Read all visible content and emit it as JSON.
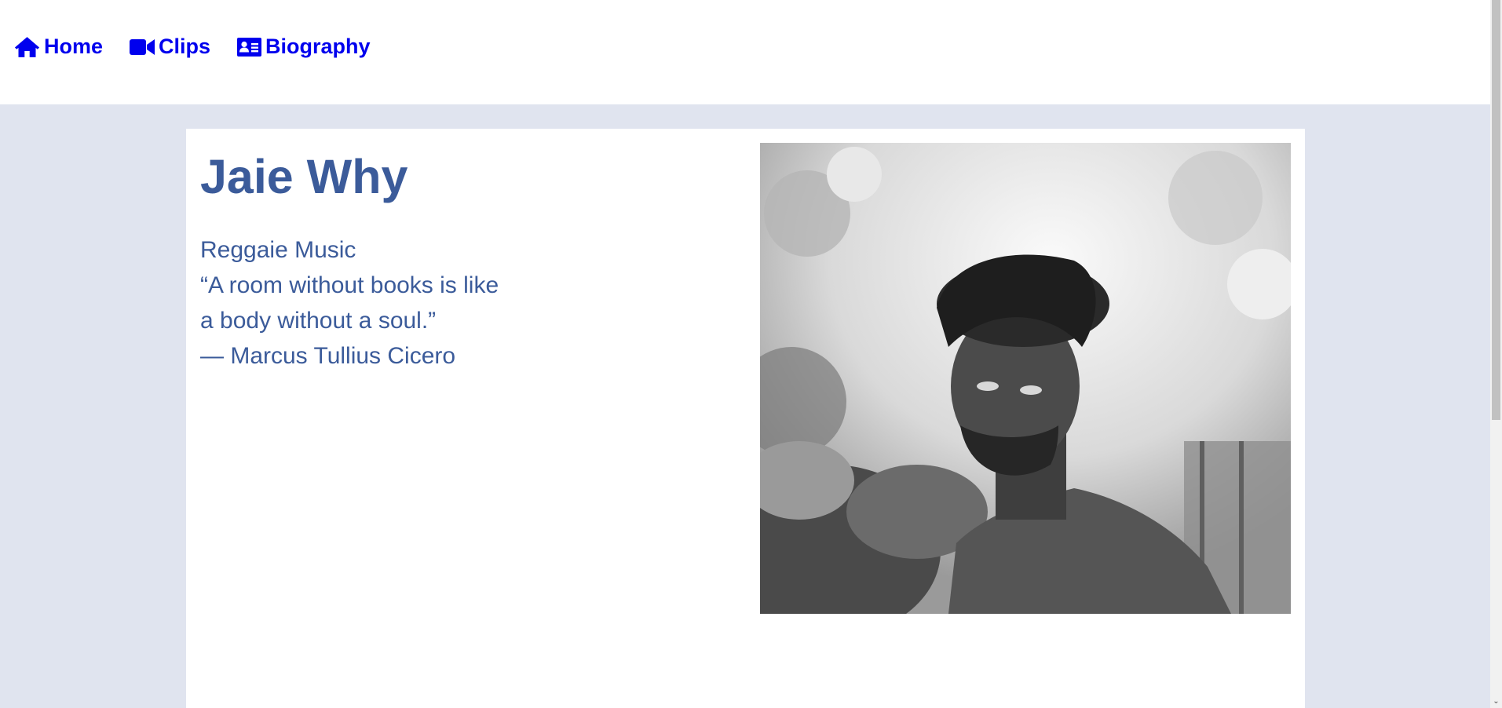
{
  "nav": {
    "items": [
      {
        "label": "Home",
        "icon": "home-icon"
      },
      {
        "label": "Clips",
        "icon": "video-camera-icon"
      },
      {
        "label": "Biography",
        "icon": "id-card-icon"
      }
    ],
    "link_color": "#0000ee"
  },
  "hero": {
    "name": "Jaie Why",
    "genre": "Reggaie Music",
    "quote_line1": "“A room without books is like",
    "quote_line2": "a body without a soul.”",
    "quote_author": "— Marcus Tullius Cicero",
    "text_color": "#3b5b9a",
    "page_background": "#e0e4ef"
  },
  "scrollbar": {
    "down_arrow": "⌄"
  }
}
